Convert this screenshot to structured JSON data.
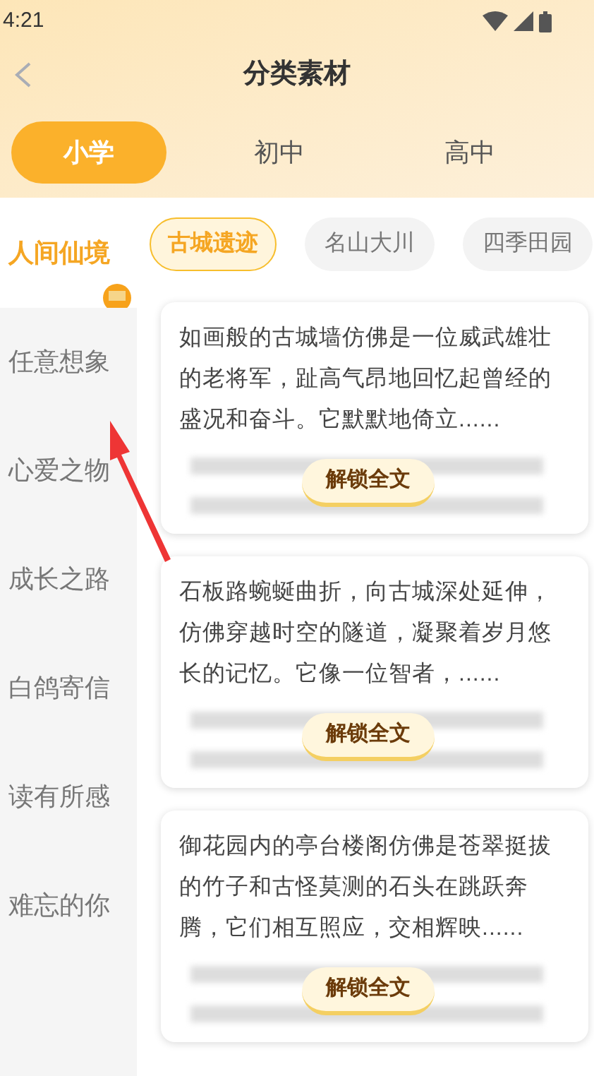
{
  "status_bar": {
    "time": "4:21"
  },
  "header": {
    "title": "分类素材"
  },
  "level_tabs": [
    {
      "label": "小学",
      "selected": true
    },
    {
      "label": "初中",
      "selected": false
    },
    {
      "label": "高中",
      "selected": false
    }
  ],
  "sidebar": {
    "items": [
      {
        "label": "人间仙境",
        "selected": true
      },
      {
        "label": "任意想象",
        "selected": false
      },
      {
        "label": "心爱之物",
        "selected": false
      },
      {
        "label": "成长之路",
        "selected": false
      },
      {
        "label": "白鸽寄信",
        "selected": false
      },
      {
        "label": "读有所感",
        "selected": false
      },
      {
        "label": "难忘的你",
        "selected": false
      }
    ]
  },
  "topic_chips": [
    {
      "label": "古城遗迹",
      "selected": true
    },
    {
      "label": "名山大川",
      "selected": false
    },
    {
      "label": "四季田园",
      "selected": false
    }
  ],
  "articles": [
    {
      "excerpt": "如画般的古城墙仿佛是一位威武雄壮的老将军，趾高气昂地回忆起曾经的盛况和奋斗。它默默地倚立......",
      "unlock_button": "解锁全文"
    },
    {
      "excerpt": "石板路蜿蜒曲折，向古城深处延伸，仿佛穿越时空的隧道，凝聚着岁月悠长的记忆。它像一位智者，......",
      "unlock_button": "解锁全文"
    },
    {
      "excerpt": "御花园内的亭台楼阁仿佛是苍翠挺拔的竹子和古怪莫测的石头在跳跃奔腾，它们相互照应，交相辉映......",
      "unlock_button": "解锁全文"
    }
  ]
}
